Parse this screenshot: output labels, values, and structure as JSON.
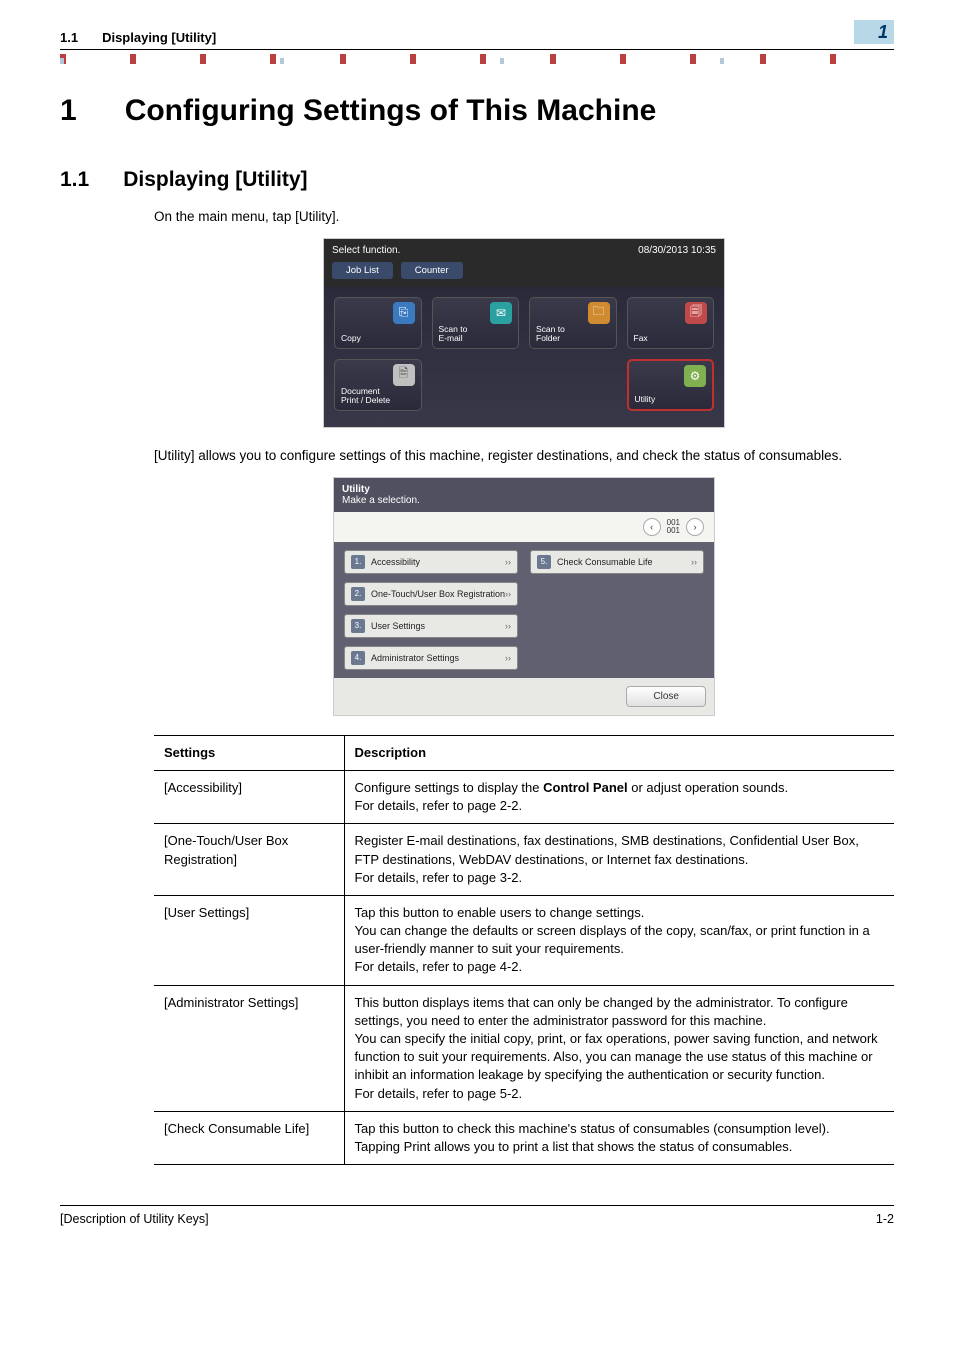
{
  "header": {
    "section_num": "1.1",
    "section_title": "Displaying [Utility]"
  },
  "chapter_badge": "1",
  "chapter": {
    "num": "1",
    "title": "Configuring Settings of This Machine"
  },
  "section": {
    "num": "1.1",
    "title": "Displaying [Utility]"
  },
  "para1": "On the main menu, tap [Utility].",
  "mainmenu": {
    "prompt": "Select function.",
    "datetime": "08/30/2013 10:35",
    "tabs": [
      "Job List",
      "Counter"
    ],
    "buttons": [
      {
        "label": "Copy",
        "icon": "copy-icon",
        "icls": "blue"
      },
      {
        "label": "Scan to\nE-mail",
        "icon": "email-icon",
        "icls": "teal"
      },
      {
        "label": "Scan to\nFolder",
        "icon": "folder-icon",
        "icls": "orange"
      },
      {
        "label": "Fax",
        "icon": "fax-icon",
        "icls": "red"
      },
      {
        "label": "Document\nPrint / Delete",
        "icon": "doc-icon",
        "icls": "gray"
      },
      {
        "label": "",
        "icon": "",
        "icls": ""
      },
      {
        "label": "",
        "icon": "",
        "icls": ""
      },
      {
        "label": "Utility",
        "icon": "gear-icon",
        "icls": "green",
        "hl": true
      }
    ]
  },
  "para2": "[Utility] allows you to configure settings of this machine, register destinations, and check the status of consumables.",
  "utility": {
    "title": "Utility",
    "subtitle": "Make a selection.",
    "page": "001\n001",
    "items_left": [
      {
        "n": "1.",
        "label": "Accessibility"
      },
      {
        "n": "2.",
        "label": "One-Touch/User Box Registration"
      },
      {
        "n": "3.",
        "label": "User Settings"
      },
      {
        "n": "4.",
        "label": "Administrator Settings"
      }
    ],
    "items_right": [
      {
        "n": "5.",
        "label": "Check Consumable Life"
      }
    ],
    "close": "Close"
  },
  "table": {
    "head": {
      "c1": "Settings",
      "c2": "Description"
    },
    "rows": [
      {
        "c1": "[Accessibility]",
        "c2_pre": "Configure settings to display the ",
        "c2_bold": "Control Panel",
        "c2_post": " or adjust operation sounds.\nFor details, refer to page 2-2."
      },
      {
        "c1": "[One-Touch/User Box Registration]",
        "c2": "Register E-mail destinations, fax destinations, SMB destinations, Confidential User Box, FTP destinations, WebDAV destinations, or Internet fax destinations.\nFor details, refer to page 3-2."
      },
      {
        "c1": "[User Settings]",
        "c2": "Tap this button to enable users to change settings.\nYou can change the defaults or screen displays of the copy, scan/fax, or print function in a user-friendly manner to suit your requirements.\nFor details, refer to page 4-2."
      },
      {
        "c1": "[Administrator Settings]",
        "c2": "This button displays items that can only be changed by the administrator. To configure settings, you need to enter the administrator password for this machine.\nYou can specify the initial copy, print, or fax operations, power saving function, and network function to suit your requirements. Also, you can manage the use status of this machine or inhibit an information leakage by specifying the authentication or security function.\nFor details, refer to page 5-2."
      },
      {
        "c1": "[Check Consumable Life]",
        "c2": "Tap this button to check this machine's status of consumables (consumption level).\nTapping Print allows you to print a list that shows the status of consumables."
      }
    ]
  },
  "footer": {
    "left": "[Description of Utility Keys]",
    "right": "1-2"
  }
}
